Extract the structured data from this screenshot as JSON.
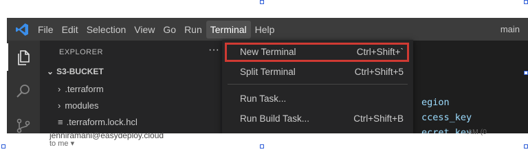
{
  "menubar": {
    "items": [
      "File",
      "Edit",
      "Selection",
      "View",
      "Go",
      "Run",
      "Terminal",
      "Help"
    ],
    "active_item": "Terminal",
    "window_title": "main"
  },
  "sidebar": {
    "title": "EXPLORER",
    "more": "···",
    "folder": "S3-BUCKET",
    "tree": [
      {
        "label": ".terraform",
        "type": "folder"
      },
      {
        "label": "modules",
        "type": "folder"
      },
      {
        "label": ".terraform.lock.hcl",
        "type": "file"
      }
    ]
  },
  "terminal_menu": {
    "items": [
      {
        "label": "New Terminal",
        "shortcut": "Ctrl+Shift+`",
        "highlighted": true
      },
      {
        "label": "Split Terminal",
        "shortcut": "Ctrl+Shift+5",
        "highlighted": false
      },
      {
        "label": "Run Task...",
        "shortcut": "",
        "highlighted": false
      },
      {
        "label": "Run Build Task...",
        "shortcut": "Ctrl+Shift+B",
        "highlighted": false
      }
    ]
  },
  "editor": {
    "lines": [
      "egion",
      "ccess_key",
      "ecret_key"
    ]
  },
  "email": {
    "sender": "jenniramani@easydeploy.cloud",
    "to": "to me ▾",
    "time": "AM (0"
  },
  "colors": {
    "highlight_border": "#d03a33",
    "vscode_blue": "#3b8eea",
    "selection_handle": "#2b5bd7"
  }
}
